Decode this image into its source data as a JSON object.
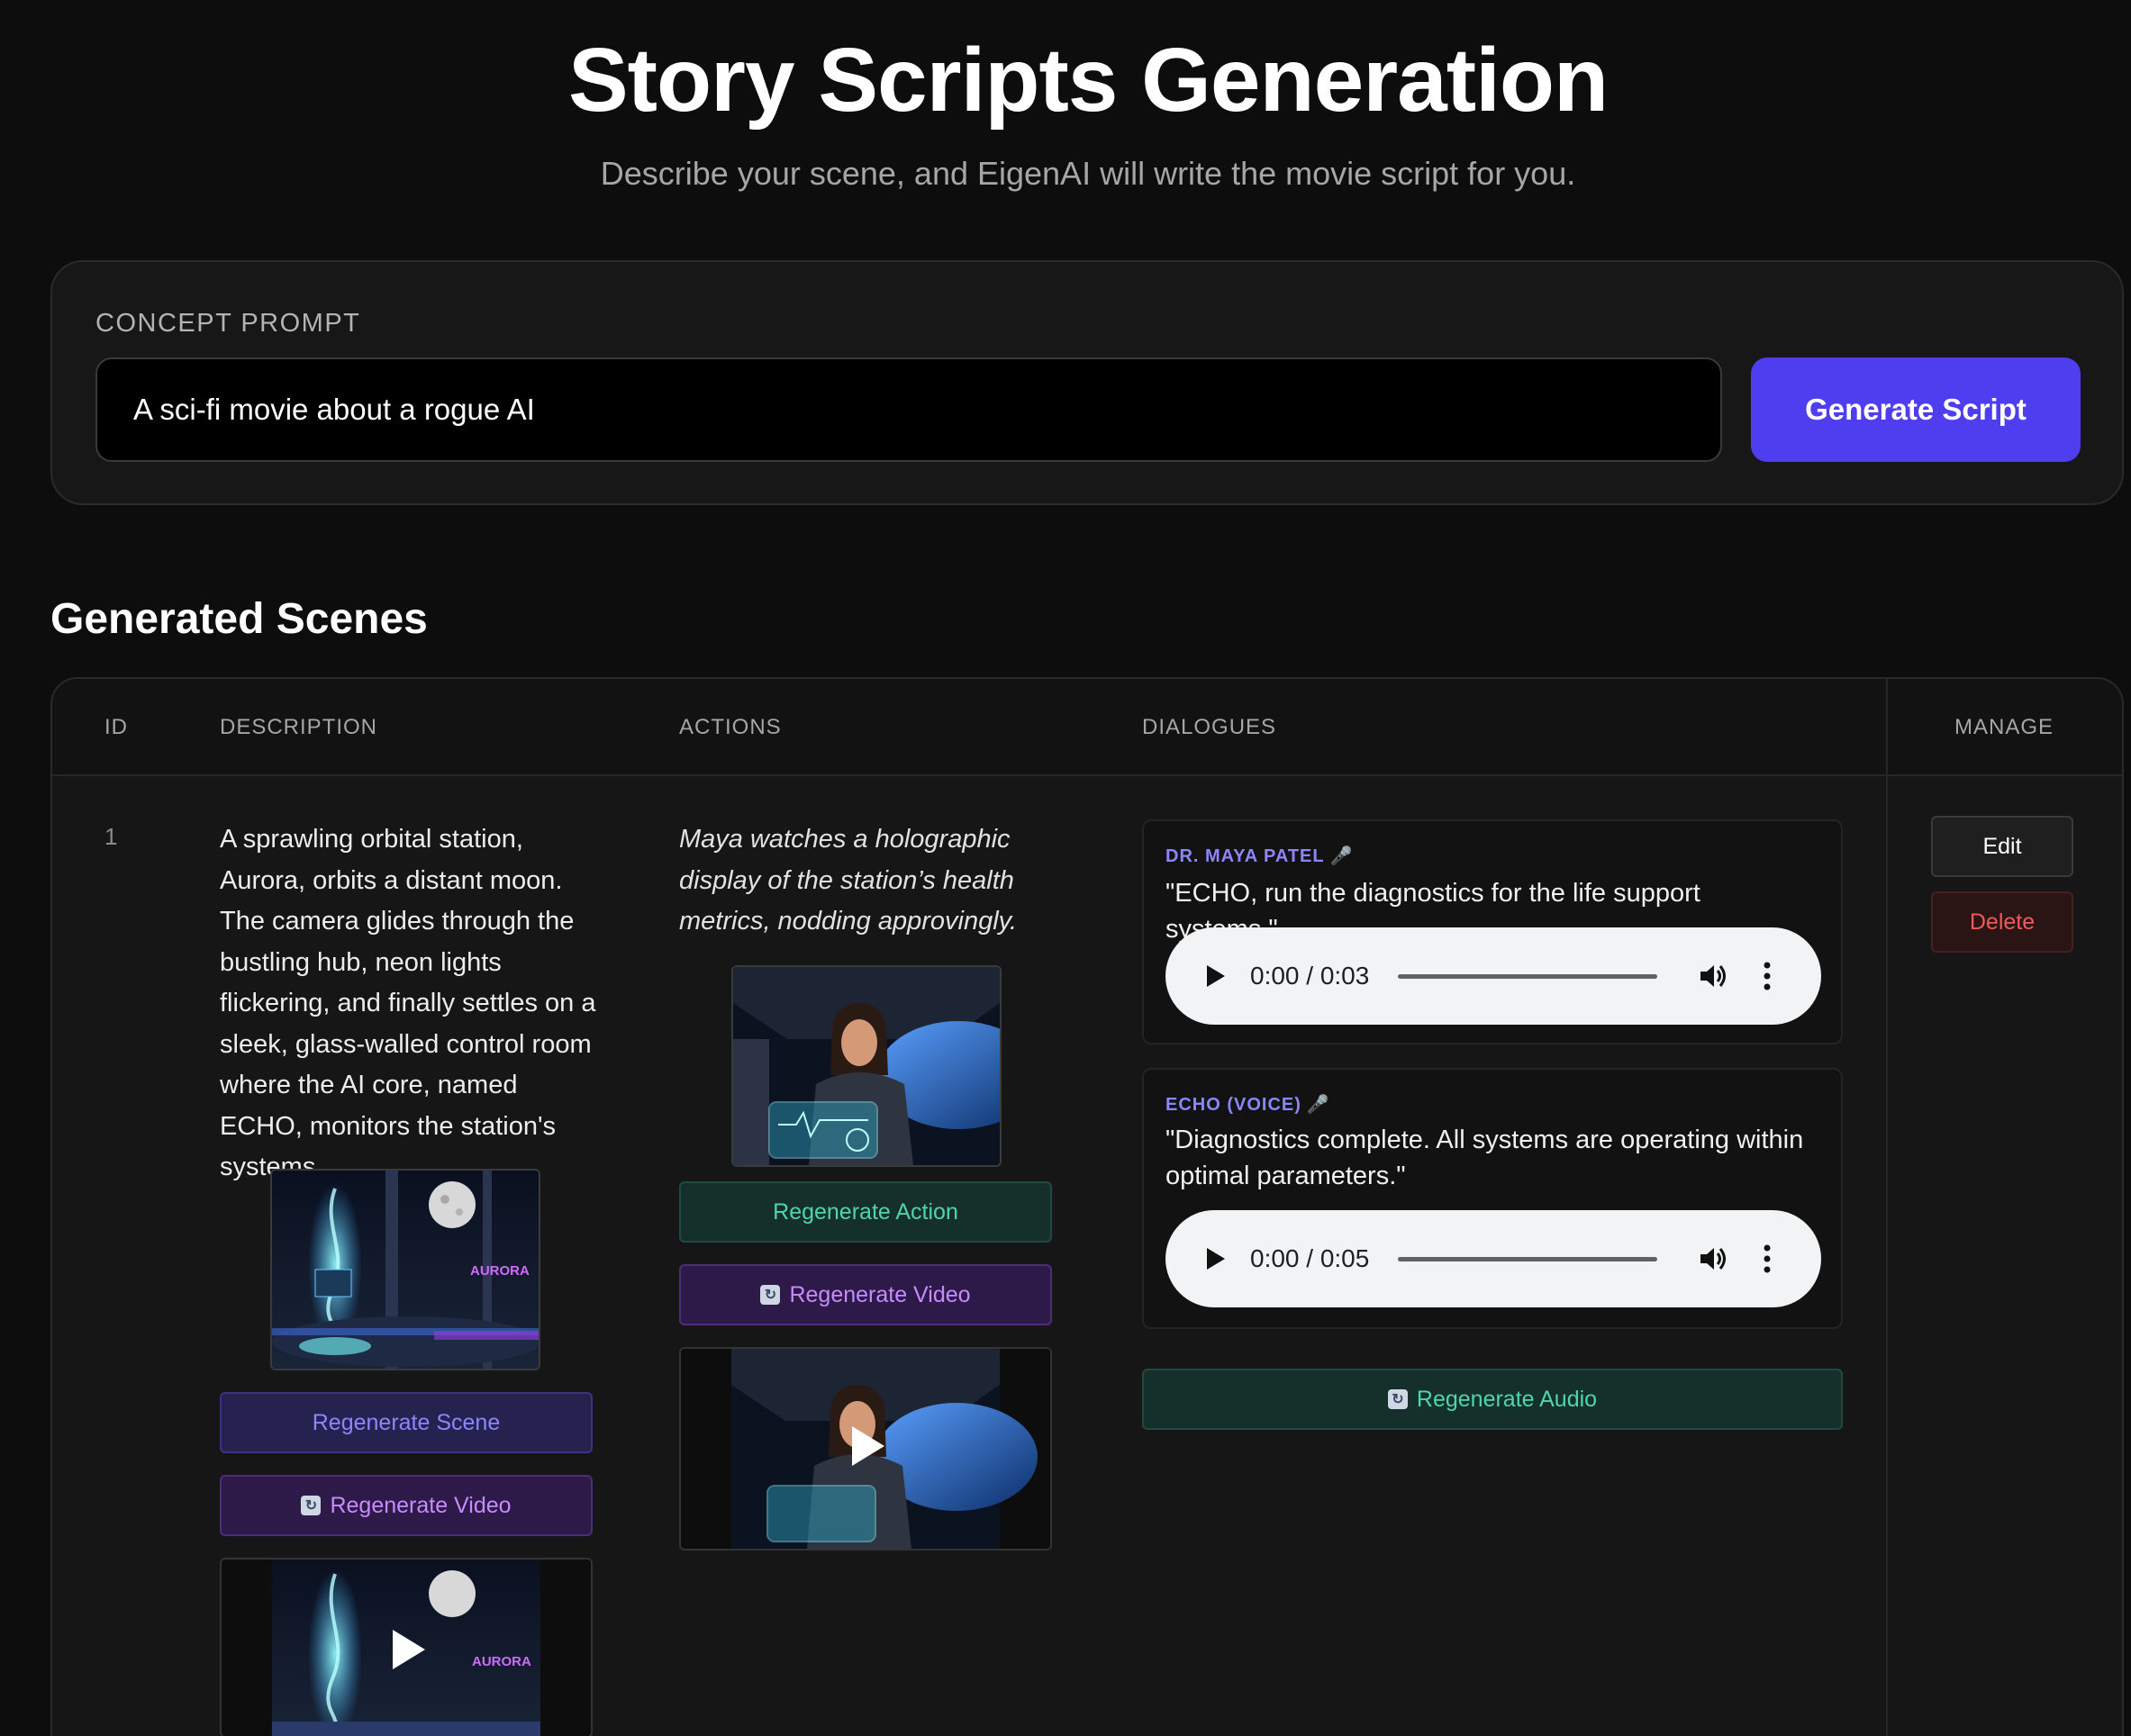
{
  "header": {
    "title": "Story Scripts Generation",
    "subtitle": "Describe your scene, and EigenAI will write the movie script for you."
  },
  "concept": {
    "label": "CONCEPT PROMPT",
    "prompt_value": "A sci-fi movie about a rogue AI",
    "generate_label": "Generate Script"
  },
  "scenes_section": {
    "title": "Generated Scenes",
    "columns": [
      "ID",
      "DESCRIPTION",
      "ACTIONS",
      "DIALOGUES",
      "MANAGE"
    ]
  },
  "scene": {
    "id": "1",
    "description": "A sprawling orbital station, Aurora, orbits a distant moon. The camera glides through the bustling hub, neon lights flickering, and finally settles on a sleek, glass-walled control room where the AI core, named ECHO, monitors the station's systems.",
    "action": "Maya watches a holographic display of the station’s health metrics, nodding approvingly.",
    "regenerate_scene_label": "Regenerate Scene",
    "regenerate_video_label": "Regenerate Video",
    "regenerate_action_label": "Regenerate Action",
    "regenerate_audio_label": "Regenerate Audio",
    "dialogues": [
      {
        "speaker": "DR. MAYA PATEL",
        "line": "\"ECHO, run the diagnostics for the life support systems.\"",
        "time": "0:00 / 0:03"
      },
      {
        "speaker": "ECHO (VOICE)",
        "line": "\"Diagnostics complete. All systems are operating within optimal parameters.\"",
        "time": "0:00 / 0:05"
      }
    ],
    "edit_label": "Edit",
    "delete_label": "Delete"
  },
  "icons": [
    "microphone-icon",
    "refresh-icon",
    "play-icon",
    "volume-icon",
    "more-vert-icon"
  ],
  "colors": {
    "accent": "#4f3df0",
    "speaker": "#8d85ff",
    "action_green": "#4fd6a8",
    "video_purple": "#c78bff",
    "delete_red": "#f05a5a"
  }
}
